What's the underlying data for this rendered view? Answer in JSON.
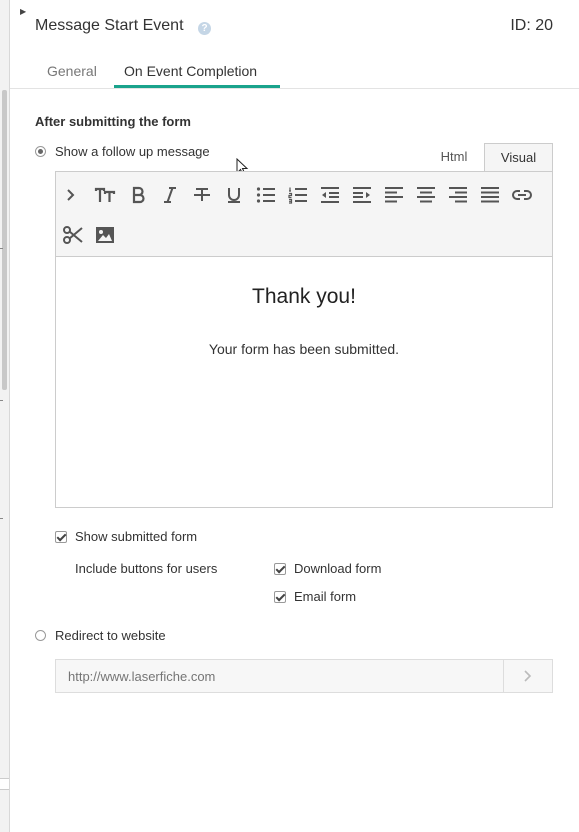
{
  "header": {
    "title": "Message Start Event",
    "help_icon": "?",
    "id_label": "ID: 20"
  },
  "tabs": [
    {
      "label": "General",
      "active": false
    },
    {
      "label": "On Event Completion",
      "active": true
    }
  ],
  "section_label": "After submitting the form",
  "options": {
    "follow_up": {
      "label": "Show a follow up message",
      "selected": true
    },
    "redirect": {
      "label": "Redirect to website",
      "selected": false
    }
  },
  "editor": {
    "modes": [
      {
        "label": "Html",
        "active": false
      },
      {
        "label": "Visual",
        "active": true
      }
    ],
    "toolbar_icons": [
      "chevron-right-icon",
      "font-size-icon",
      "bold-icon",
      "italic-icon",
      "strikethrough-icon",
      "underline-icon",
      "bullet-list-icon",
      "numbered-list-icon",
      "outdent-icon",
      "indent-icon",
      "align-left-icon",
      "align-center-icon",
      "align-right-icon",
      "align-justify-icon",
      "link-icon",
      "scissors-icon",
      "image-icon"
    ],
    "content_heading": "Thank you!",
    "content_text": "Your form has been submitted."
  },
  "submitted_form": {
    "show_label": "Show submitted form",
    "show_checked": true,
    "include_label": "Include buttons for users",
    "download_label": "Download form",
    "download_checked": true,
    "email_label": "Email form",
    "email_checked": true
  },
  "redirect": {
    "placeholder": "http://www.laserfiche.com"
  },
  "colors": {
    "accent": "#1aa38c",
    "help": "#c5d6e6"
  }
}
